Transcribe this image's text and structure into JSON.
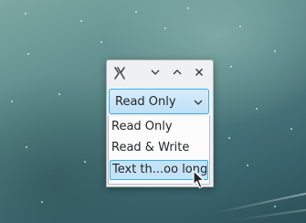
{
  "window": {
    "titlebar": {
      "icon": "x-app-icon",
      "buttons": [
        "chevron-down-icon",
        "chevron-up-icon",
        "close-icon"
      ]
    },
    "combo": {
      "selected": "Read Only",
      "arrow_icon": "chevron-down-icon"
    },
    "dropdown": {
      "items": [
        {
          "label": "Read Only"
        },
        {
          "label": "Read & Write"
        },
        {
          "label": "Text th...oo long"
        }
      ],
      "hovered_index": 2
    }
  },
  "colors": {
    "accent": "#3daee9",
    "selection_bg": "#c4e3f7",
    "window_bg": "#eff0f1",
    "text": "#232627"
  }
}
